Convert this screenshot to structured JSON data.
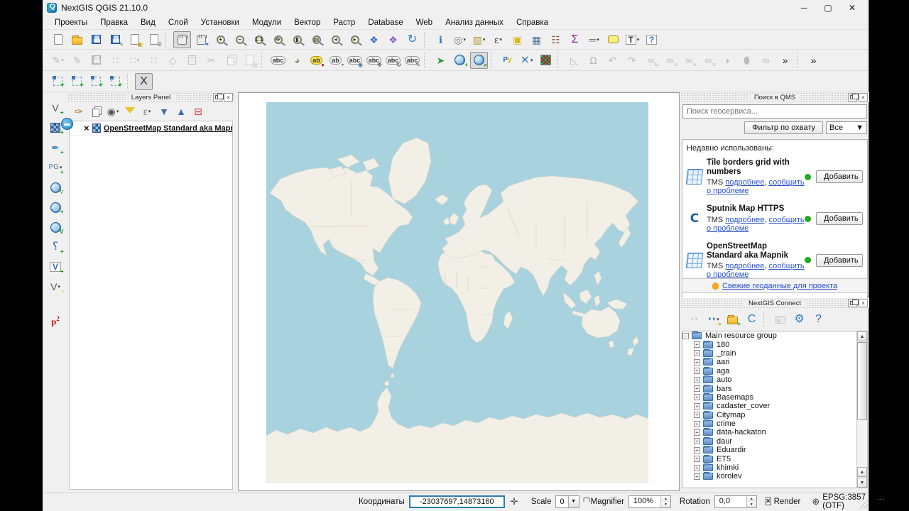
{
  "window": {
    "title": "NextGIS QGIS 21.10.0",
    "minimize": "─",
    "maximize": "▢",
    "close": "✕"
  },
  "menu": {
    "items": [
      "Проекты",
      "Правка",
      "Вид",
      "Слой",
      "Установки",
      "Модули",
      "Вектор",
      "Растр",
      "Database",
      "Web",
      "Анализ данных",
      "Справка"
    ]
  },
  "colors": {
    "ocean": "#a9d2df",
    "land": "#f2efe7",
    "land_border": "#d9d2c5",
    "country_border": "#e0c5a0",
    "status_ok": "#1faa1f",
    "link": "#2953cc"
  },
  "toolbars": {
    "row1": [
      {
        "n": "new-project-icon",
        "t": "page"
      },
      {
        "n": "open-project-icon",
        "t": "folder"
      },
      {
        "n": "save-project-icon",
        "t": "floppy"
      },
      {
        "n": "save-project-as-icon",
        "t": "floppy",
        "badge": "✎",
        "bc": "#2a7f2a"
      },
      {
        "n": "new-print-layout-icon",
        "t": "page",
        "badge": "▣",
        "bc": "#c9a612"
      },
      {
        "n": "layout-manager-icon",
        "t": "page",
        "badge": "⚙",
        "bc": "#777"
      },
      {
        "sep": true
      },
      {
        "n": "pan-map-icon",
        "t": "hand",
        "state": "pressed"
      },
      {
        "n": "pan-to-selection-icon",
        "t": "hand",
        "badge": "✦",
        "bc": "#2a6fbf"
      },
      {
        "n": "zoom-in-icon",
        "t": "zoom",
        "g": "+"
      },
      {
        "n": "zoom-out-icon",
        "t": "zoom",
        "g": "−"
      },
      {
        "n": "zoom-native-icon",
        "t": "zoom",
        "g": "1:1"
      },
      {
        "n": "zoom-full-icon",
        "t": "zoom",
        "g": "✥"
      },
      {
        "n": "zoom-to-selection-icon",
        "t": "zoom",
        "g": "▮"
      },
      {
        "n": "zoom-to-layer-icon",
        "t": "zoom",
        "g": "▤"
      },
      {
        "n": "zoom-last-icon",
        "t": "zoom",
        "g": "◂"
      },
      {
        "n": "zoom-next-icon",
        "t": "zoom",
        "g": "▸"
      },
      {
        "n": "new-bookmark-icon",
        "t": "glyph",
        "g": "❖",
        "c": "#3a6fc4"
      },
      {
        "n": "show-bookmarks-icon",
        "t": "glyph",
        "g": "❖",
        "c": "#8a5fc4"
      },
      {
        "n": "refresh-map-icon",
        "t": "glyph",
        "g": "↻",
        "c": "#2a7fbf",
        "big": true
      },
      {
        "sep": true
      },
      {
        "n": "identify-features-icon",
        "t": "glyph",
        "g": "ℹ",
        "c": "#2a7fbf"
      },
      {
        "n": "run-feature-action-icon",
        "t": "glyph",
        "g": "◎",
        "c": "#777",
        "dd": true
      },
      {
        "n": "select-features-icon",
        "t": "glyph",
        "g": "▧",
        "c": "#b59a3a",
        "dd": true
      },
      {
        "n": "select-by-expression-icon",
        "t": "glyph",
        "g": "ε",
        "c": "#555",
        "dd": true
      },
      {
        "n": "deselect-all-icon",
        "t": "glyph",
        "g": "▣",
        "c": "#d8b91c"
      },
      {
        "n": "attribute-table-icon",
        "t": "glyph",
        "g": "▦",
        "c": "#557799"
      },
      {
        "n": "field-calculator-icon",
        "t": "glyph",
        "g": "☷",
        "c": "#885533"
      },
      {
        "n": "statistics-icon",
        "t": "glyph",
        "g": "Σ",
        "c": "#8b1a8b",
        "big": true
      },
      {
        "n": "measure-icon",
        "t": "glyph",
        "g": "═",
        "c": "#777",
        "dd": true
      },
      {
        "n": "map-tips-icon",
        "t": "bubble"
      },
      {
        "n": "text-annotation-icon",
        "t": "glyph",
        "g": "T",
        "c": "#333",
        "boxed": true,
        "dd": true
      },
      {
        "n": "help-contents-icon",
        "t": "glyph",
        "g": "?",
        "c": "#2a6fbf",
        "boxed": true
      }
    ],
    "row2": [
      {
        "n": "current-edits-icon",
        "t": "glyph",
        "g": "✎",
        "c": "#666",
        "state": "disabled",
        "dd": true
      },
      {
        "n": "toggle-editing-icon",
        "t": "glyph",
        "g": "✎",
        "c": "#666",
        "state": "disabled"
      },
      {
        "n": "save-layer-edits-icon",
        "t": "floppy",
        "state": "disabled"
      },
      {
        "n": "add-feature-icon",
        "t": "glyph",
        "g": "∷",
        "c": "#666",
        "state": "disabled"
      },
      {
        "n": "move-feature-icon",
        "t": "glyph",
        "g": "∷",
        "c": "#666",
        "state": "disabled",
        "dd": true
      },
      {
        "n": "add-part-icon",
        "t": "glyph",
        "g": "∷",
        "c": "#666",
        "state": "disabled"
      },
      {
        "n": "vertex-tool-icon",
        "t": "glyph",
        "g": "◇",
        "c": "#666",
        "state": "disabled"
      },
      {
        "n": "delete-selected-icon",
        "t": "trash",
        "state": "disabled"
      },
      {
        "n": "cut-features-icon",
        "t": "glyph",
        "g": "✂",
        "c": "#666",
        "state": "disabled"
      },
      {
        "n": "copy-features-icon",
        "t": "copy",
        "state": "disabled"
      },
      {
        "n": "paste-features-icon",
        "t": "page",
        "badge": "▤",
        "bc": "#888",
        "state": "disabled"
      },
      {
        "sep": true
      },
      {
        "n": "label-toolbar-icon",
        "t": "abc",
        "g": "abc"
      },
      {
        "n": "diagram-icon",
        "t": "glyph",
        "g": "◕",
        "c": "#8a9a8a"
      },
      {
        "n": "layer-labeling-icon",
        "t": "abc",
        "g": "ab",
        "hl": true,
        "badge": "●",
        "bc": "#cc2222"
      },
      {
        "n": "label-pin-icon",
        "t": "abc",
        "g": "ab",
        "badge": "•",
        "bc": "#555"
      },
      {
        "n": "label-highlight-icon",
        "t": "abc",
        "g": "abc",
        "badge": "◉",
        "bc": "#557799"
      },
      {
        "n": "label-move-icon",
        "t": "abc",
        "g": "abc",
        "badge": "✥",
        "bc": "#555"
      },
      {
        "n": "label-rotate-icon",
        "t": "abc",
        "g": "abc",
        "badge": "↻",
        "bc": "#555"
      },
      {
        "n": "label-properties-icon",
        "t": "abc",
        "g": "abc",
        "badge": "✎",
        "bc": "#2a7f2a"
      },
      {
        "sep": true
      },
      {
        "n": "nextgis-identify-icon",
        "t": "glyph",
        "g": "➤",
        "c": "#3a9a3a"
      },
      {
        "n": "nextgis-add-layer-icon",
        "t": "globe",
        "badge": "+",
        "bc": "#0a8a0a"
      },
      {
        "n": "qms-search-icon",
        "t": "globe",
        "badge": "⌕",
        "bc": "#0a8a0a",
        "state": "pressed"
      },
      {
        "sep": true
      },
      {
        "n": "python-console-icon",
        "t": "python"
      },
      {
        "n": "processing-toolbox-icon",
        "t": "glyph",
        "g": "⨯",
        "c": "#2a6fbf",
        "big": true,
        "dd": true
      },
      {
        "n": "checker-plugin-icon",
        "t": "checker-color"
      },
      {
        "sep": true
      },
      {
        "n": "geometry-tool-icon",
        "t": "glyph",
        "g": "◺",
        "c": "#666",
        "state": "disabled"
      },
      {
        "n": "snapping-icon",
        "t": "glyph",
        "g": "Ω",
        "c": "#993333",
        "state": "disabled"
      },
      {
        "n": "undo-icon",
        "t": "glyph",
        "g": "↶",
        "c": "#666",
        "state": "disabled"
      },
      {
        "n": "redo-icon",
        "t": "glyph",
        "g": "↷",
        "c": "#666",
        "state": "disabled"
      },
      {
        "n": "offset-curve-icon",
        "t": "glyph",
        "g": "∞",
        "c": "#666",
        "state": "disabled",
        "badge": "↻",
        "bc": "#777"
      },
      {
        "n": "reshape-features-icon",
        "t": "glyph",
        "g": "∞",
        "c": "#666",
        "state": "disabled",
        "badge": "✕",
        "bc": "#777"
      },
      {
        "n": "split-features-icon",
        "t": "glyph",
        "g": "∞",
        "c": "#666",
        "state": "disabled",
        "badge": "✕",
        "bc": "#777"
      },
      {
        "n": "split-parts-icon",
        "t": "glyph",
        "g": "∞",
        "c": "#666",
        "state": "disabled",
        "badge": "✕",
        "bc": "#777"
      },
      {
        "n": "merge-features-icon",
        "t": "glyph",
        "g": "◗",
        "c": "#666",
        "state": "disabled"
      },
      {
        "n": "rotate-feature-icon",
        "t": "glyph",
        "g": "⬮",
        "c": "#666",
        "state": "disabled"
      },
      {
        "n": "trim-extend-icon",
        "t": "glyph",
        "g": "∞",
        "c": "#666",
        "state": "disabled"
      },
      {
        "n": "toolbar-overflow-1",
        "t": "glyph",
        "g": "»",
        "c": "#222"
      },
      {
        "sep": true
      },
      {
        "n": "toolbar-overflow-2",
        "t": "glyph",
        "g": "»",
        "c": "#222"
      }
    ],
    "row3": [
      {
        "n": "topology-node-icon",
        "t": "nodes"
      },
      {
        "n": "topology-square-icon",
        "t": "nodes"
      },
      {
        "n": "topology-select-icon",
        "t": "nodes"
      },
      {
        "n": "topology-zoom-icon",
        "t": "nodes"
      },
      {
        "sep": true
      },
      {
        "n": "x-plugin-icon",
        "t": "glyph",
        "g": "X",
        "c": "#1a2f5a",
        "big": true,
        "state": "pressed"
      }
    ],
    "left": [
      {
        "n": "add-vector-layer-icon",
        "t": "glyph",
        "g": "V",
        "c": "#555",
        "badge": "+",
        "bc": "#0a8a0a"
      },
      {
        "n": "add-raster-layer-icon",
        "t": "checker",
        "badge": "+",
        "bc": "#0a8a0a"
      },
      {
        "n": "add-mesh-layer-icon",
        "t": "glyph",
        "g": "✒",
        "c": "#3a7fbf",
        "badge": "+",
        "bc": "#0a8a0a"
      },
      {
        "n": "add-postgis-layer-icon",
        "t": "glyph",
        "g": "PG",
        "c": "#5a7a9a",
        "small": true,
        "badge": "+",
        "bc": "#0a8a0a",
        "dd": true
      },
      {
        "n": "add-spatialite-layer-icon",
        "t": "globe",
        "badge": "∵",
        "bc": "#0a8a0a"
      },
      {
        "n": "add-wms-layer-icon",
        "t": "globe",
        "badge": "+",
        "bc": "#0a8a0a"
      },
      {
        "n": "add-wcs-layer-icon",
        "t": "globe",
        "badge": "V",
        "bc": "#0a8a0a"
      },
      {
        "n": "add-wfs-layer-icon",
        "t": "glyph",
        "g": "؟",
        "c": "#2a6fbf",
        "big": true,
        "badge": "+",
        "bc": "#0a8a0a"
      },
      {
        "n": "add-virtual-layer-icon",
        "t": "glyph",
        "g": "V",
        "c": "#3a6fa4",
        "boxed": true,
        "badge": "+",
        "bc": "#0a8a0a"
      },
      {
        "n": "new-shapefile-layer-icon",
        "t": "glyph",
        "g": "V",
        "c": "#555",
        "badge": "▪",
        "bc": "#d8b91c",
        "dd": true
      }
    ],
    "layers_panel": [
      {
        "n": "open-style-manager-icon",
        "t": "glyph",
        "g": "✑",
        "c": "#b5782a"
      },
      {
        "n": "add-group-icon",
        "t": "copy"
      },
      {
        "n": "manage-map-themes-icon",
        "t": "glyph",
        "g": "◉",
        "c": "#555",
        "dd": true
      },
      {
        "n": "filter-legend-icon",
        "t": "funnel"
      },
      {
        "n": "filter-by-expression-icon",
        "t": "glyph",
        "g": "ε",
        "c": "#888",
        "dd": true
      },
      {
        "n": "expand-all-icon",
        "t": "glyph",
        "g": "▼",
        "c": "#3a6fa4"
      },
      {
        "n": "collapse-all-icon",
        "t": "glyph",
        "g": "▲",
        "c": "#3a6fa4"
      },
      {
        "n": "remove-layer-icon",
        "t": "glyph",
        "g": "⊟",
        "c": "#cc3333"
      }
    ],
    "connect": [
      {
        "n": "connect-account-icon",
        "t": "glyph",
        "g": "◖◗",
        "c": "#888",
        "state": "disabled",
        "small": true
      },
      {
        "n": "connect-add-icon",
        "t": "glyph",
        "g": "◖◗",
        "c": "#2a6fbf",
        "small": true,
        "badge": "➜",
        "bc": "#d8a812",
        "dd": true
      },
      {
        "n": "connect-new-group-icon",
        "t": "folder",
        "badge": "+",
        "bc": "#0a8a0a"
      },
      {
        "n": "connect-refresh-icon",
        "t": "glyph",
        "g": "C",
        "c": "#2a7fbf",
        "big": true
      },
      {
        "sep": true
      },
      {
        "n": "connect-image-icon",
        "t": "img",
        "state": "disabled"
      },
      {
        "n": "connect-settings-icon",
        "t": "glyph",
        "g": "⚙",
        "c": "#3a7fc1",
        "big": true
      },
      {
        "n": "connect-help-icon",
        "t": "glyph",
        "g": "?",
        "c": "#2a6fbf",
        "big": true
      }
    ]
  },
  "layers_panel": {
    "title": "Layers Panel",
    "layer": {
      "checkbox": "×",
      "name": "OpenStreetMap Standard aka Mapnik"
    }
  },
  "qms": {
    "title": "Поиск в QMS",
    "search_placeholder": "Поиск геосервиса...",
    "filter_button": "Фильтр по охвату",
    "type_filter_value": "Все",
    "recent_label": "Недавно использованы:",
    "services": [
      {
        "icon": "tile-map",
        "title": "Tile borders grid with numbers",
        "type": "TMS",
        "details_link": "подробнее",
        "report_link": "сообщить о проблеме",
        "add_button": "Добавить"
      },
      {
        "icon": "sputnik",
        "title": "Sputnik Map HTTPS",
        "type": "TMS",
        "details_link": "подробнее",
        "report_link": "сообщить о проблеме",
        "add_button": "Добавить"
      },
      {
        "icon": "tile-map",
        "title": "OpenStreetMap Standard aka Mapnik",
        "type": "TMS",
        "details_link": "подробнее",
        "report_link": "сообщить о проблеме",
        "add_button": "Добавить"
      }
    ],
    "fresh_geodata_link": "Свежие геоданные для проекта"
  },
  "connect": {
    "title": "NextGIS Connect",
    "tree_root": "Main resource group",
    "tree_items": [
      "180",
      "_train",
      "aari",
      "aga",
      "auto",
      "bars",
      "Basemaps",
      "cadaster_cover",
      "Citymap",
      "crime",
      "data-hackaton",
      "daur",
      "Eduardir",
      "ET5",
      "khimki",
      "korolev"
    ]
  },
  "statusbar": {
    "coordinates_label": "Координаты",
    "coordinates_value": "-23037697,14873160",
    "scale_label": "Scale",
    "scale_value": "0",
    "magnifier_label": "Magnifier",
    "magnifier_value": "100%",
    "rotation_label": "Rotation",
    "rotation_value": "0,0",
    "render_label": "Render",
    "render_checked": "×",
    "crs_value": "EPSG:3857 (OTF)"
  },
  "misc": {
    "p2_label": "p",
    "p2_sup": "2"
  }
}
